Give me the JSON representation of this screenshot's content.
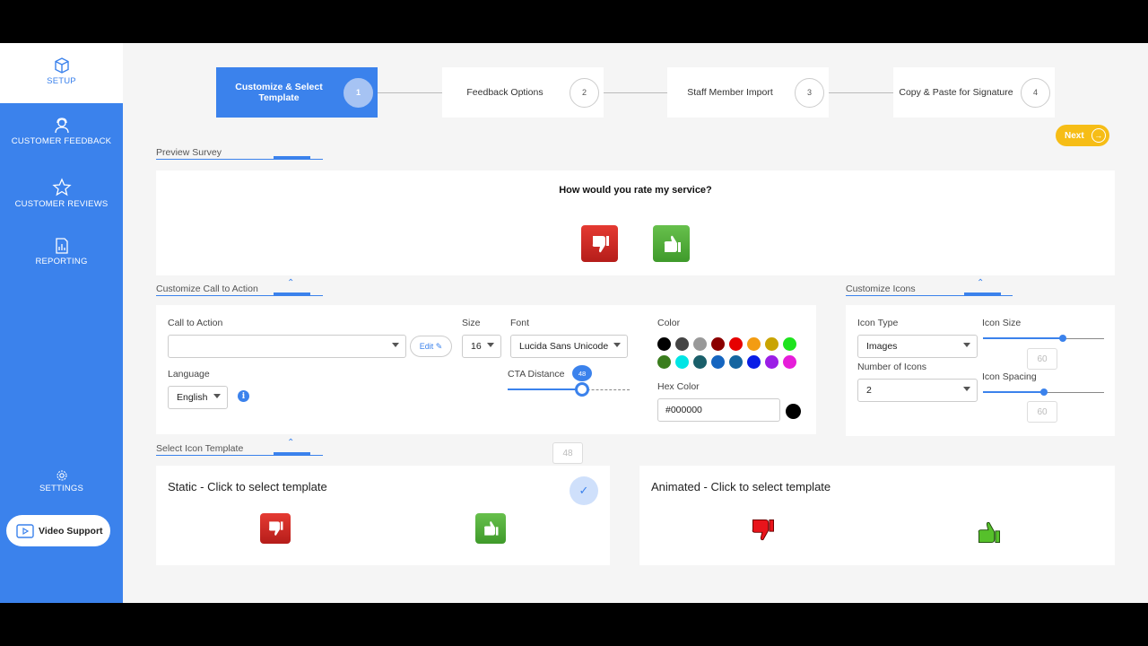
{
  "sidebar": {
    "items": [
      {
        "label": "SETUP",
        "icon": "box-icon"
      },
      {
        "label": "CUSTOMER FEEDBACK",
        "icon": "agent-icon"
      },
      {
        "label": "CUSTOMER REVIEWS",
        "icon": "star-icon"
      },
      {
        "label": "REPORTING",
        "icon": "report-icon"
      },
      {
        "label": "SETTINGS",
        "icon": "gear-icon"
      }
    ],
    "video_support": "Video Support"
  },
  "steps": [
    {
      "label": "Customize & Select Template",
      "num": "1"
    },
    {
      "label": "Feedback Options",
      "num": "2"
    },
    {
      "label": "Staff Member Import",
      "num": "3"
    },
    {
      "label": "Copy & Paste for Signature",
      "num": "4"
    }
  ],
  "next_label": "Next",
  "preview": {
    "header": "Preview Survey",
    "question": "How would you rate my service?"
  },
  "cta": {
    "header": "Customize Call to Action",
    "call_to_action_label": "Call to Action",
    "call_to_action_value": "",
    "edit_label": "Edit",
    "size_label": "Size",
    "size_value": "16",
    "font_label": "Font",
    "font_value": "Lucida Sans Unicode",
    "language_label": "Language",
    "language_value": "English",
    "distance_label": "CTA Distance",
    "distance_value": "48",
    "distance_fraction": 0.61,
    "color_label": "Color",
    "hex_label": "Hex Color",
    "hex_value": "#000000",
    "colors": [
      "#000000",
      "#444444",
      "#999999",
      "#8b0000",
      "#e60000",
      "#f39c12",
      "#c9a400",
      "#1ee31e",
      "#3a7d1d",
      "#00e5e5",
      "#1a5f6a",
      "#1565c0",
      "#1565a0",
      "#0a1ee6",
      "#9b1ee6",
      "#e61ed9"
    ],
    "selected_color": "#000000"
  },
  "icons_panel": {
    "header": "Customize Icons",
    "type_label": "Icon Type",
    "type_value": "Images",
    "count_label": "Number of Icons",
    "count_value": "2",
    "size_label": "Icon Size",
    "size_value": "60",
    "size_fraction": 0.66,
    "spacing_label": "Icon Spacing",
    "spacing_value": "60",
    "spacing_fraction": 0.5
  },
  "templates": {
    "header": "Select Icon Template",
    "static_title": "Static - Click to select template",
    "animated_title": "Animated - Click to select template"
  }
}
